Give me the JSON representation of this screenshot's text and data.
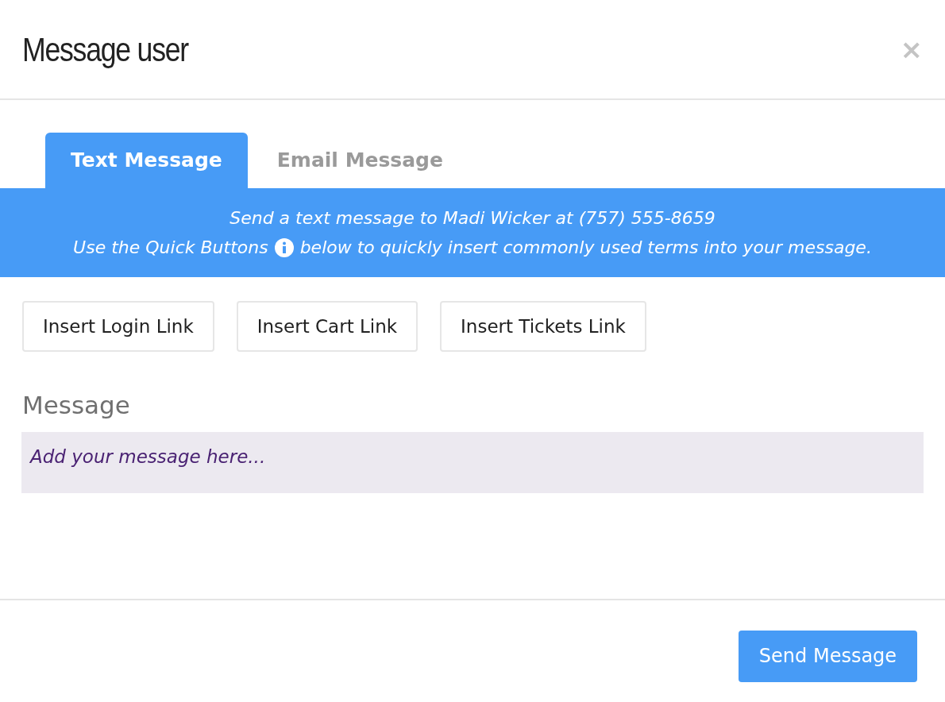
{
  "dialog": {
    "title": "Message user",
    "close": "×"
  },
  "tabs": [
    {
      "label": "Text Message",
      "selected": true
    },
    {
      "label": "Email Message",
      "selected": false
    }
  ],
  "banner": {
    "line_1": "Send a text message to Madi Wicker at (757) 555-8659",
    "line_2_before_icon": "Use the Quick Buttons",
    "line_2_after_icon": "below to quickly insert commonly used terms into your message."
  },
  "quick_buttons": [
    "Insert Login Link",
    "Insert Cart Link",
    "Insert Tickets Link"
  ],
  "message": {
    "label": "Message",
    "placeholder": "Add your message here..."
  },
  "footer": {
    "send_button": "Send Message"
  }
}
